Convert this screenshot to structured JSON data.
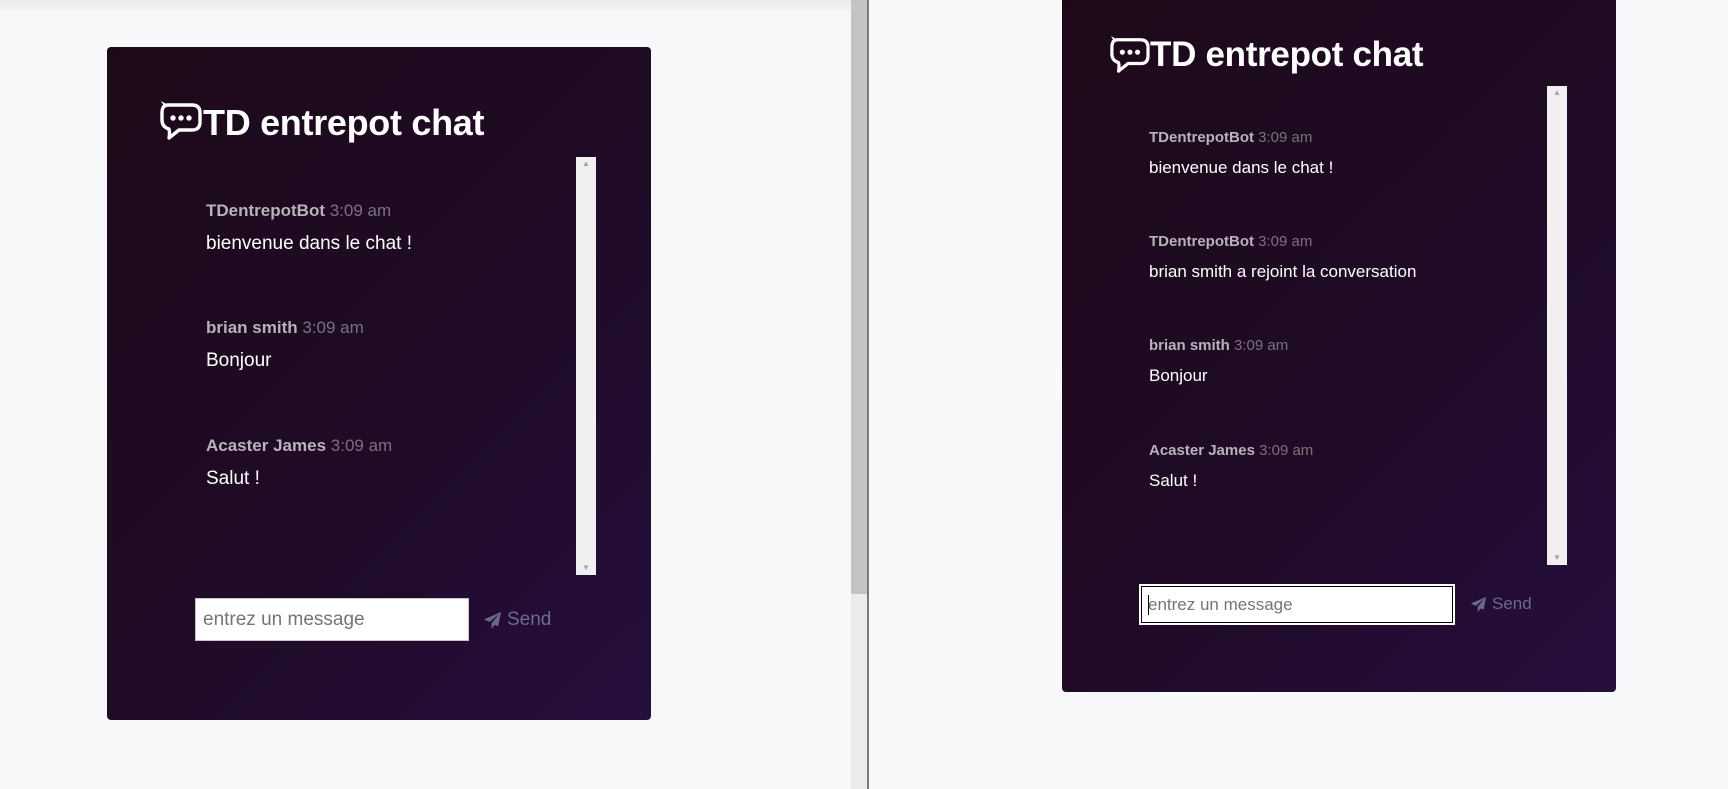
{
  "app": {
    "title": "TD entrepot chat",
    "logo_icon": "chat-bubble-icon"
  },
  "left_window": {
    "messages": [
      {
        "author": "TDentrepotBot",
        "time": "3:09 am",
        "text": "bienvenue dans le chat !"
      },
      {
        "author": "brian smith",
        "time": "3:09 am",
        "text": "Bonjour"
      },
      {
        "author": "Acaster James",
        "time": "3:09 am",
        "text": "Salut !"
      }
    ],
    "input": {
      "placeholder": "entrez un message",
      "value": ""
    },
    "send": {
      "label": "Send",
      "icon": "paper-plane-icon"
    }
  },
  "right_window": {
    "messages": [
      {
        "author": "TDentrepotBot",
        "time": "3:09 am",
        "text": "bienvenue dans le chat !"
      },
      {
        "author": "TDentrepotBot",
        "time": "3:09 am",
        "text": "brian smith a rejoint la conversation"
      },
      {
        "author": "brian smith",
        "time": "3:09 am",
        "text": "Bonjour"
      },
      {
        "author": "Acaster James",
        "time": "3:09 am",
        "text": "Salut !"
      }
    ],
    "input": {
      "placeholder": "entrez un message",
      "value": ""
    },
    "send": {
      "label": "Send",
      "icon": "paper-plane-icon"
    }
  },
  "colors": {
    "card_background": "#1f0b26",
    "author": "#b8b2bb",
    "timestamp": "#7b717e",
    "send_button": "#6c6a8c"
  }
}
